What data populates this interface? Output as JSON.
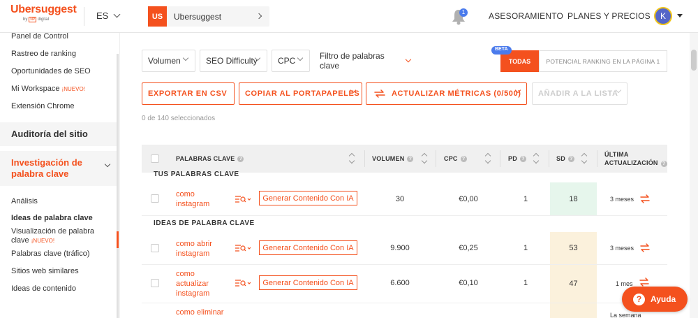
{
  "header": {
    "logo": "Ubersuggest",
    "logo_by": "by",
    "logo_np": "NP",
    "logo_digital": "digital",
    "language": "ES",
    "project_badge": "US",
    "project_name": "Ubersuggest",
    "notifications_count": "1",
    "nav_consulting": "ASESORAMIENTO",
    "nav_plans": "PLANES Y PRECIOS",
    "avatar_initial": "K"
  },
  "sidebar": {
    "items_top": [
      "Panel de Control",
      "Rastreo de ranking",
      "Oportunidades de SEO",
      "Mi Workspace",
      "Extensión Chrome"
    ],
    "workspace_new": "¡NUEVO!",
    "site_audit": "Auditoría del sitio",
    "keyword_research_line1": "Investigación de",
    "keyword_research_line2": "palabra clave",
    "sub_items": {
      "analysis": "Análisis",
      "keyword_ideas": "Ideas de palabra clave",
      "visualization_line1": "Visualización de palabra",
      "visualization_line2": "clave",
      "visualization_new": "¡NUEVO!",
      "traffic_keywords": "Palabras clave (tráfico)",
      "similar_sites": "Sitios web similares",
      "content_ideas": "Ideas de contenido"
    }
  },
  "filters": {
    "volume": "Volumen",
    "seo_difficulty": "SEO Difficulty",
    "cpc": "CPC",
    "keyword_filter": "Filtro de palabras clave"
  },
  "tabs": {
    "beta": "BETA",
    "all": "TODAS",
    "potential": "POTENCIAL RANKING EN LA PÁGINA 1"
  },
  "actions": {
    "export_csv": "EXPORTAR EN CSV",
    "copy_clipboard": "COPIAR AL PORTAPAPELES",
    "update_metrics": "ACTUALIZAR MÉTRICAS (0/500)",
    "add_to_list": "AÑADIR A LA LISTA",
    "selected_count": "0 de 140 seleccionados"
  },
  "table": {
    "headers": {
      "keywords": "PALABRAS CLAVE",
      "volume": "VOLUMEN",
      "cpc": "CPC",
      "pd": "PD",
      "sd": "SD",
      "last_update_line1": "ÚLTIMA",
      "last_update_line2": "ACTUALIZACIÓN"
    },
    "group_your_keywords": "TUS PALABRAS CLAVE",
    "group_ideas": "IDEAS DE PALABRA CLAVE",
    "generate_label": "Generar Contenido Con IA",
    "rows": [
      {
        "kw1": "como",
        "kw2": "instagram",
        "kw3": "",
        "volume": "30",
        "cpc": "€0,00",
        "pd": "1",
        "sd": "18",
        "sd_color": "#e6f6ec",
        "updated": "3 meses"
      },
      {
        "kw1": "como abrir",
        "kw2": "instagram",
        "kw3": "",
        "volume": "9.900",
        "cpc": "€0,25",
        "pd": "1",
        "sd": "53",
        "sd_color": "#fbf1dc",
        "updated": "3 meses"
      },
      {
        "kw1": "como",
        "kw2": "actualizar",
        "kw3": "instagram",
        "volume": "6.600",
        "cpc": "€0,10",
        "pd": "1",
        "sd": "47",
        "sd_color": "#fbf1dc",
        "updated": "1 mes"
      },
      {
        "kw1": "como eliminar",
        "kw2": "",
        "kw3": "",
        "volume": "",
        "cpc": "",
        "pd": "",
        "sd": "",
        "sd_color": "#fbf1dc",
        "updated": "La semana"
      }
    ]
  },
  "help": "Ayuda",
  "colors": {
    "accent": "#f4511e",
    "beta": "#4b7bec",
    "sd_easy": "#e6f6ec",
    "sd_medium": "#fbf1dc"
  }
}
